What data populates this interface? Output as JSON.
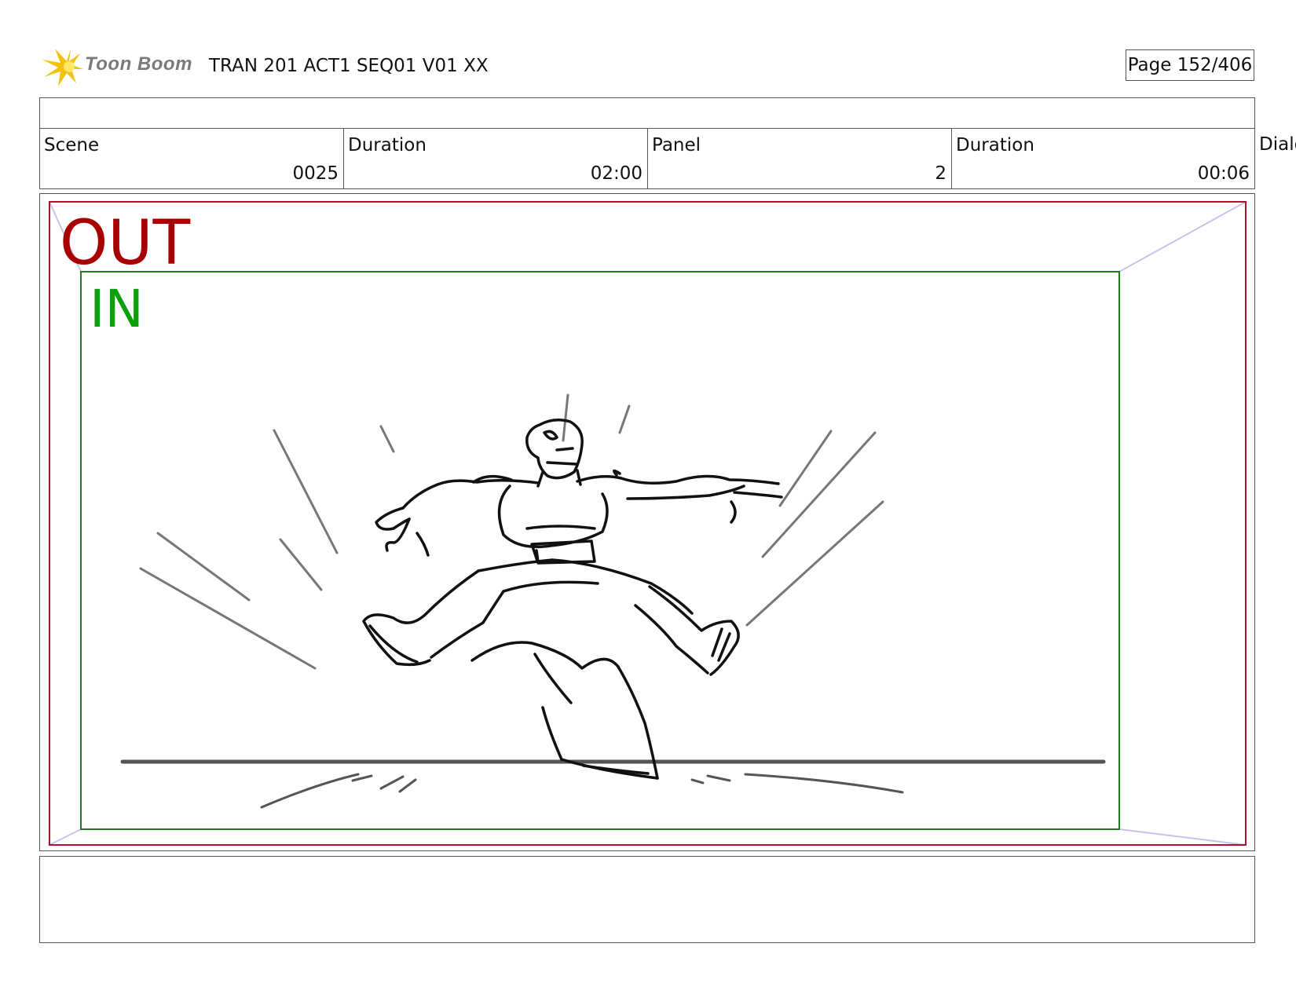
{
  "header": {
    "logo_text": "Toon Boom",
    "doc_title": "TRAN 201 ACT1 SEQ01 V01 XX",
    "page_label": "Page 152/406"
  },
  "info": {
    "scene_label": "Scene",
    "scene_value": "0025",
    "scene_duration_label": "Duration",
    "scene_duration_value": "02:00",
    "panel_label": "Panel",
    "panel_value": "2",
    "panel_duration_label": "Duration",
    "panel_duration_value": "00:06",
    "dialog_label": "Dialo"
  },
  "panel": {
    "out_label": "OUT",
    "in_label": "IN",
    "colors": {
      "out_frame": "#b0102a",
      "in_frame": "#1f7a1f",
      "guide": "#c4c4ec",
      "sketch": "#111111",
      "speed_lines": "#777777"
    }
  },
  "notes": {
    "text": ""
  }
}
